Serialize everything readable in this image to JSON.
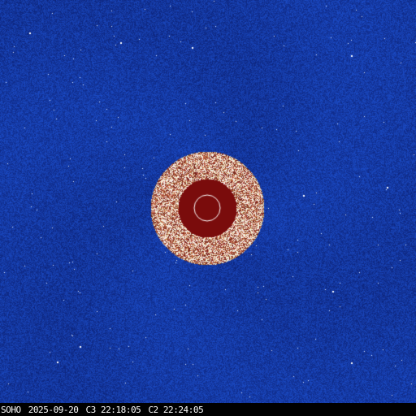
{
  "caption": {
    "observatory": "SOHO",
    "date": "2025-09-20",
    "c3": "C3 22:18:05",
    "c2": "C2 22:24:05"
  },
  "colors": {
    "background_blue": "#2050b8",
    "occulter_red": "#7a0c0c",
    "sun_outline": "#ffffff",
    "caption_bar": "#000000",
    "caption_text": "#ffffff"
  }
}
